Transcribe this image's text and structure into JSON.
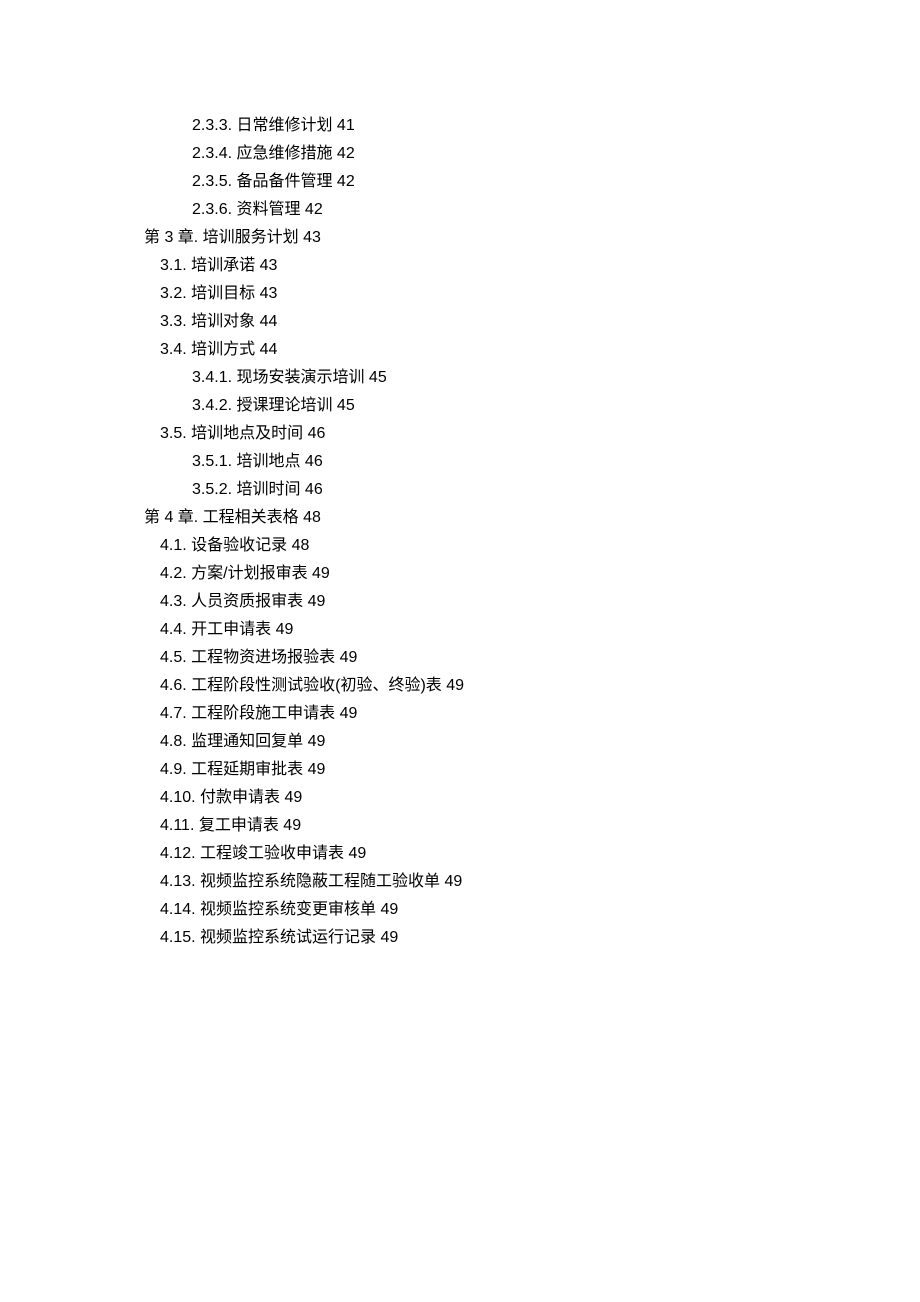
{
  "toc": [
    {
      "level": 3,
      "text": "2.3.3.  日常维修计划 41"
    },
    {
      "level": 3,
      "text": "2.3.4.  应急维修措施 42"
    },
    {
      "level": 3,
      "text": "2.3.5.  备品备件管理 42"
    },
    {
      "level": 3,
      "text": "2.3.6.  资料管理 42"
    },
    {
      "level": 1,
      "text": "第 3 章.  培训服务计划 43"
    },
    {
      "level": 2,
      "text": "3.1.  培训承诺 43"
    },
    {
      "level": 2,
      "text": "3.2.  培训目标 43"
    },
    {
      "level": 2,
      "text": "3.3.  培训对象 44"
    },
    {
      "level": 2,
      "text": "3.4.  培训方式 44"
    },
    {
      "level": 3,
      "text": "3.4.1.  现场安装演示培训 45"
    },
    {
      "level": 3,
      "text": "3.4.2.  授课理论培训 45"
    },
    {
      "level": 2,
      "text": "3.5.  培训地点及时间 46"
    },
    {
      "level": 3,
      "text": "3.5.1.  培训地点 46"
    },
    {
      "level": 3,
      "text": "3.5.2.  培训时间 46"
    },
    {
      "level": 1,
      "text": "第 4 章.  工程相关表格 48"
    },
    {
      "level": 2,
      "text": "4.1.  设备验收记录 48"
    },
    {
      "level": 2,
      "text": "4.2.  方案/计划报审表 49"
    },
    {
      "level": 2,
      "text": "4.3.  人员资质报审表 49"
    },
    {
      "level": 2,
      "text": "4.4.  开工申请表 49"
    },
    {
      "level": 2,
      "text": "4.5.  工程物资进场报验表 49"
    },
    {
      "level": 2,
      "text": "4.6.  工程阶段性测试验收(初验、终验)表 49"
    },
    {
      "level": 2,
      "text": "4.7.  工程阶段施工申请表 49"
    },
    {
      "level": 2,
      "text": "4.8.  监理通知回复单 49"
    },
    {
      "level": 2,
      "text": "4.9.  工程延期审批表 49"
    },
    {
      "level": 2,
      "text": "4.10.  付款申请表 49"
    },
    {
      "level": 2,
      "text": "4.11.  复工申请表 49"
    },
    {
      "level": 2,
      "text": "4.12.  工程竣工验收申请表 49"
    },
    {
      "level": 2,
      "text": "4.13.  视频监控系统隐蔽工程随工验收单 49"
    },
    {
      "level": 2,
      "text": "4.14.  视频监控系统变更审核单 49"
    },
    {
      "level": 2,
      "text": "4.15.  视频监控系统试运行记录 49"
    }
  ]
}
